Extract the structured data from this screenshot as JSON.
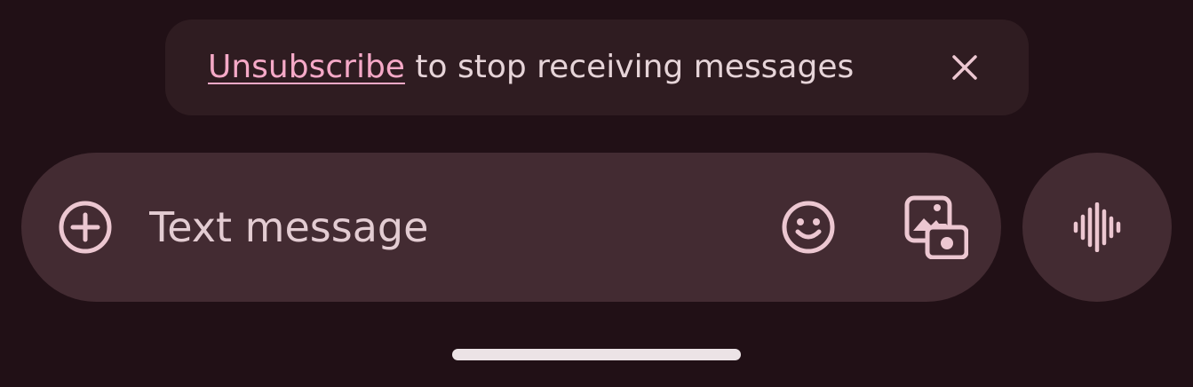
{
  "banner": {
    "link_text": "Unsubscribe",
    "message_text": " to stop receiving messages",
    "close_icon": "close-icon"
  },
  "composer": {
    "placeholder": "Text message",
    "value": "",
    "add_icon": "add-circle-icon",
    "emoji_icon": "emoji-icon",
    "gallery_icon": "gallery-camera-icon"
  },
  "voice": {
    "icon": "voice-waveform-icon"
  },
  "colors": {
    "background": "#211016",
    "banner_bg": "#2f1c21",
    "composer_bg": "#432b32",
    "accent_link": "#f5a9c7",
    "icon": "#ecc7d1"
  }
}
